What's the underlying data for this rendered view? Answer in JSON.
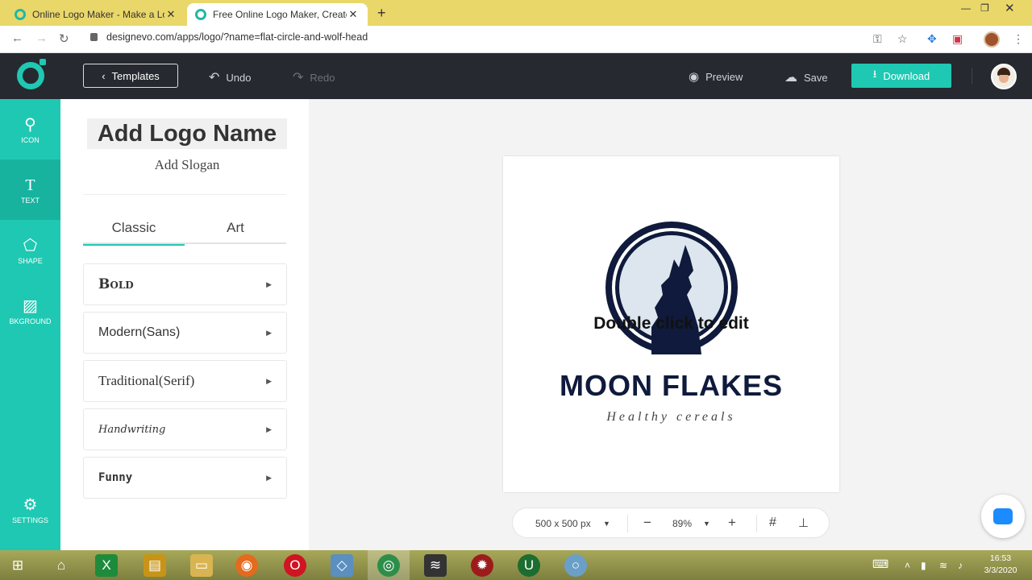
{
  "browser": {
    "tabs": [
      {
        "title": "Online Logo Maker - Make a Logo",
        "active": false
      },
      {
        "title": "Free Online Logo Maker, Create C",
        "active": true
      }
    ],
    "url": "designevo.com/apps/logo/?name=flat-circle-and-wolf-head"
  },
  "header": {
    "templates_label": "Templates",
    "undo_label": "Undo",
    "redo_label": "Redo",
    "preview_label": "Preview",
    "save_label": "Save",
    "download_label": "Download"
  },
  "rail": {
    "items": [
      {
        "label": "ICON",
        "icon": "search-icon"
      },
      {
        "label": "TEXT",
        "icon": "text-icon"
      },
      {
        "label": "SHAPE",
        "icon": "shape-icon"
      },
      {
        "label": "BKGROUND",
        "icon": "background-icon"
      }
    ],
    "settings_label": "SETTINGS"
  },
  "panel": {
    "add_name": "Add Logo Name",
    "add_slogan": "Add Slogan",
    "tabs": [
      "Classic",
      "Art"
    ],
    "font_categories": [
      "Bold",
      "Modern(Sans)",
      "Traditional(Serif)",
      "Handwriting",
      "Funny"
    ]
  },
  "canvas": {
    "edit_hint": "Double click to edit",
    "brand_name": "MOON FLAKES",
    "slogan": "Healthy cereals",
    "colors": {
      "navy": "#0f1a3c",
      "moon": "#dde6ee"
    }
  },
  "toolbar": {
    "size": "500 x 500 px",
    "zoom": "89%"
  },
  "taskbar": {
    "time": "16:53",
    "date": "3/3/2020"
  },
  "colors": {
    "accent": "#1fc8b2",
    "header": "#26292f"
  }
}
